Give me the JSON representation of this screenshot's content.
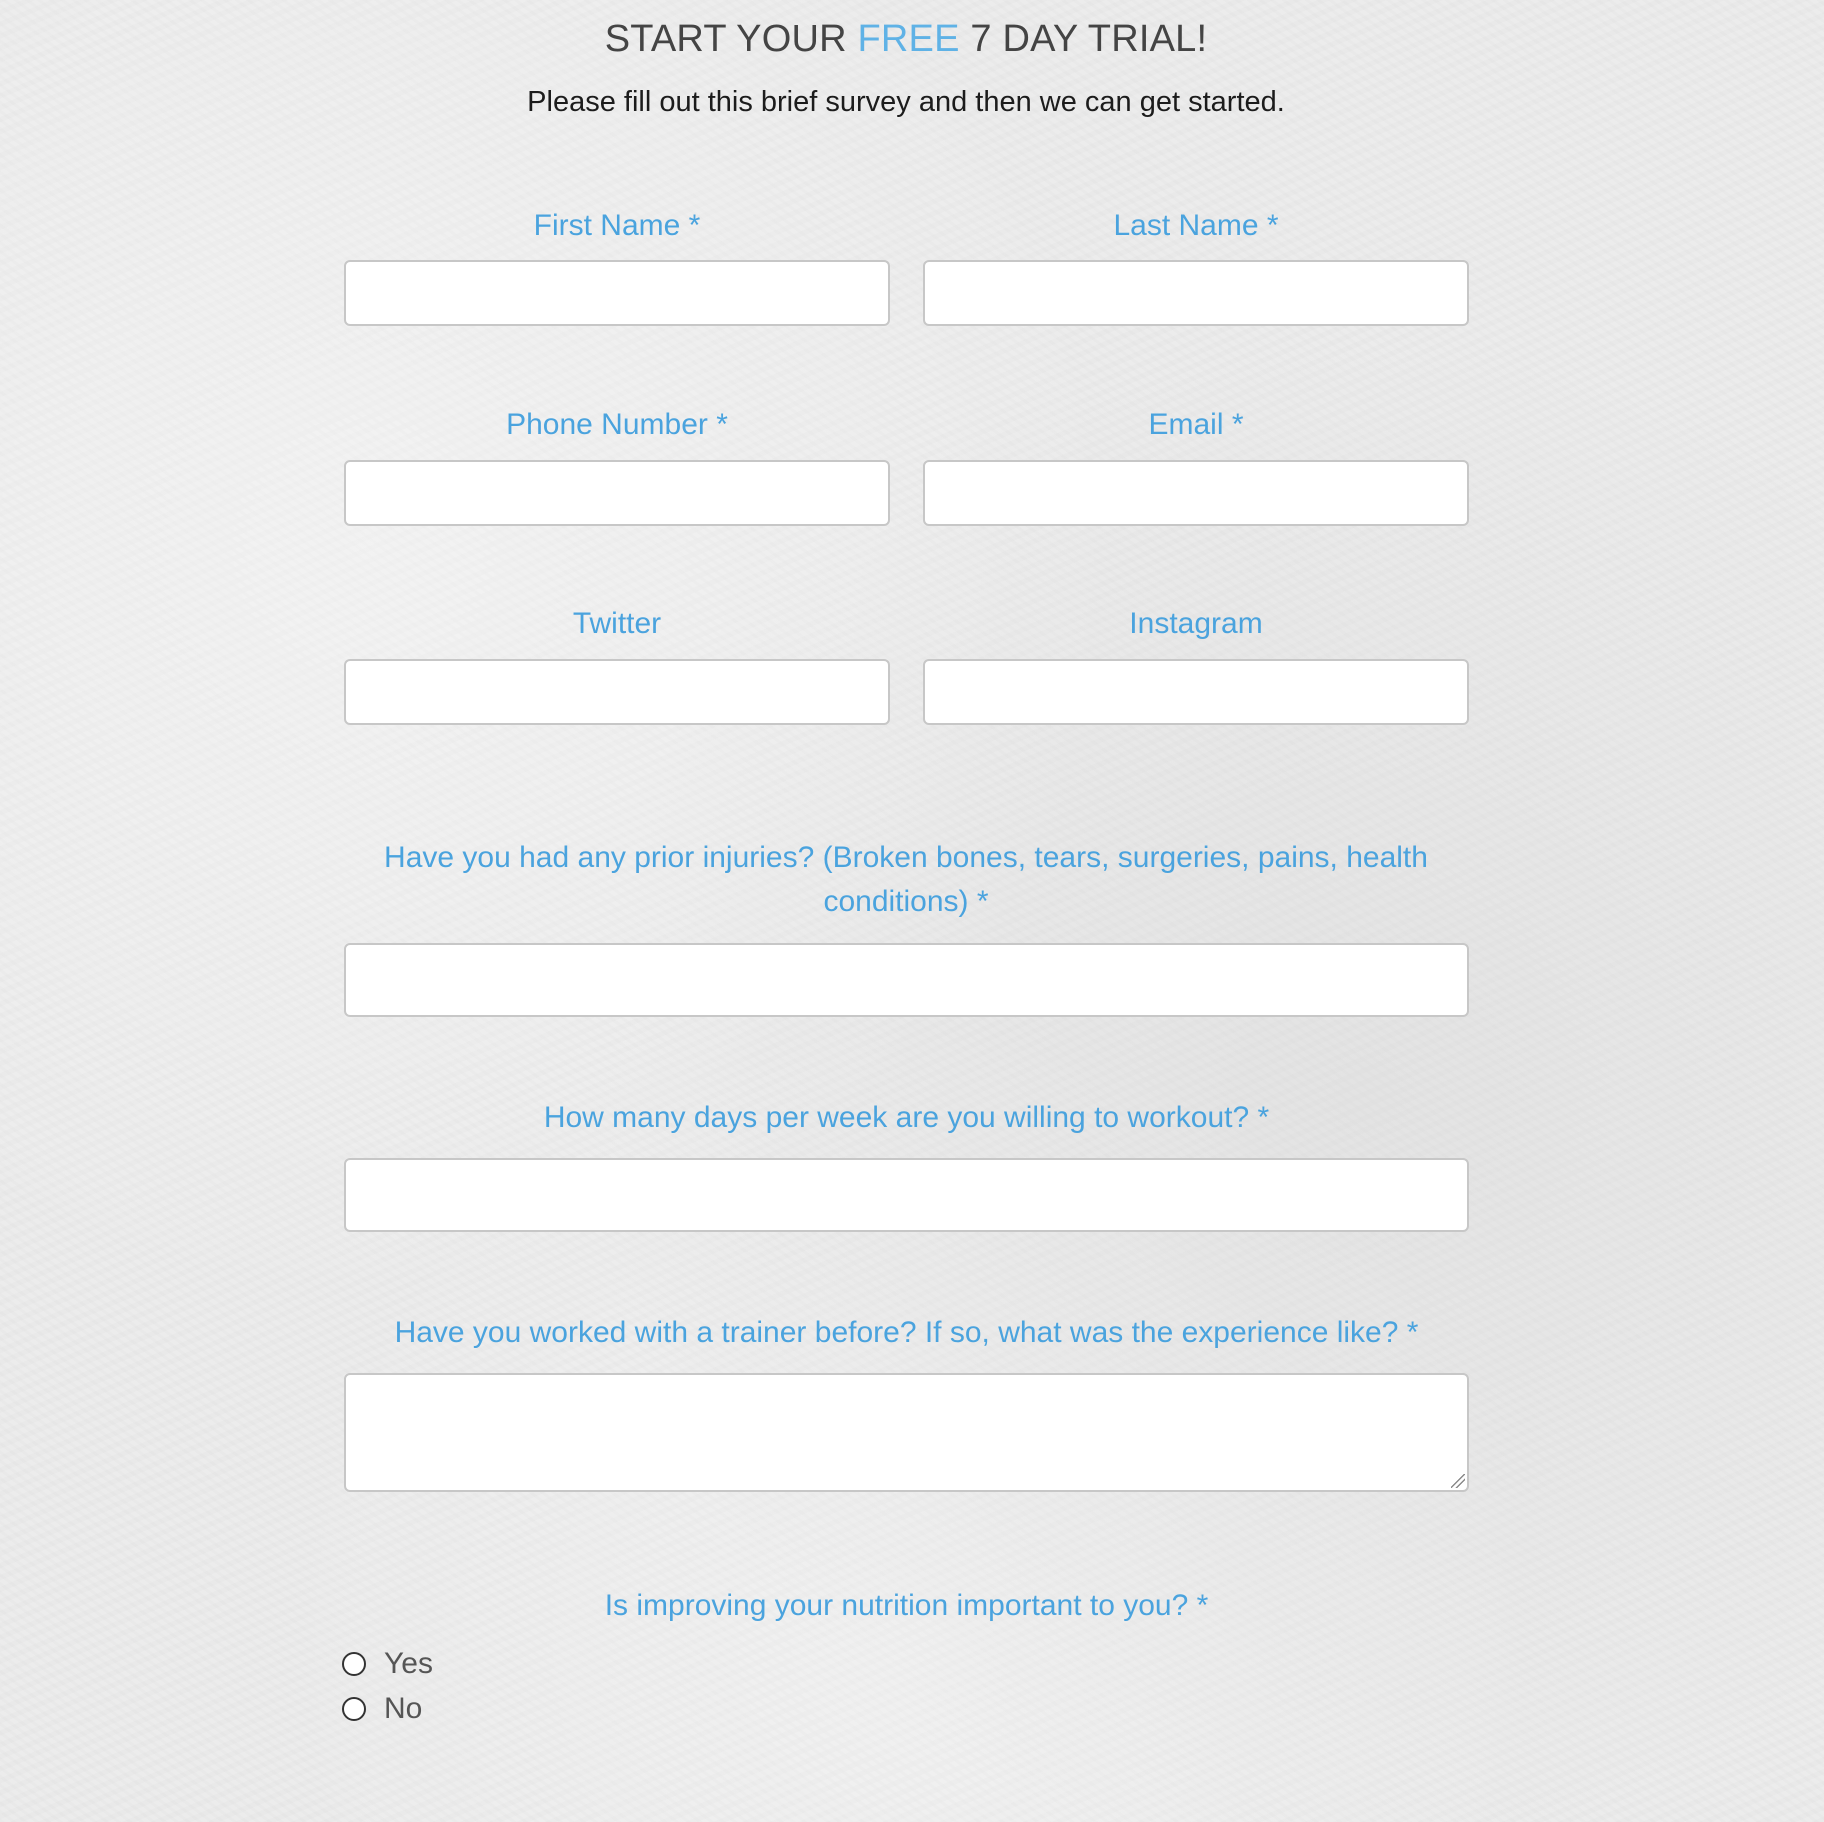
{
  "header": {
    "title_prefix": "START YOUR ",
    "title_accent": "FREE",
    "title_suffix": " 7 DAY TRIAL!",
    "subtitle": "Please fill out this brief survey and then we can get started."
  },
  "form": {
    "first_name_label": "First Name *",
    "last_name_label": "Last Name *",
    "phone_label": "Phone Number *",
    "email_label": "Email *",
    "twitter_label": "Twitter",
    "instagram_label": "Instagram",
    "injuries_label": "Have you had any prior injuries? (Broken bones, tears, surgeries, pains, health conditions) *",
    "days_label": "How many days per week are you willing to workout? *",
    "trainer_label": "Have you worked with a trainer before? If so, what was the experience like? *",
    "nutrition_label": "Is improving your nutrition important to you? *",
    "nutrition_options": [
      "Yes",
      "No"
    ]
  },
  "colors": {
    "accent": "#5fb2e6",
    "label": "#4aa3de",
    "title": "#444444"
  }
}
